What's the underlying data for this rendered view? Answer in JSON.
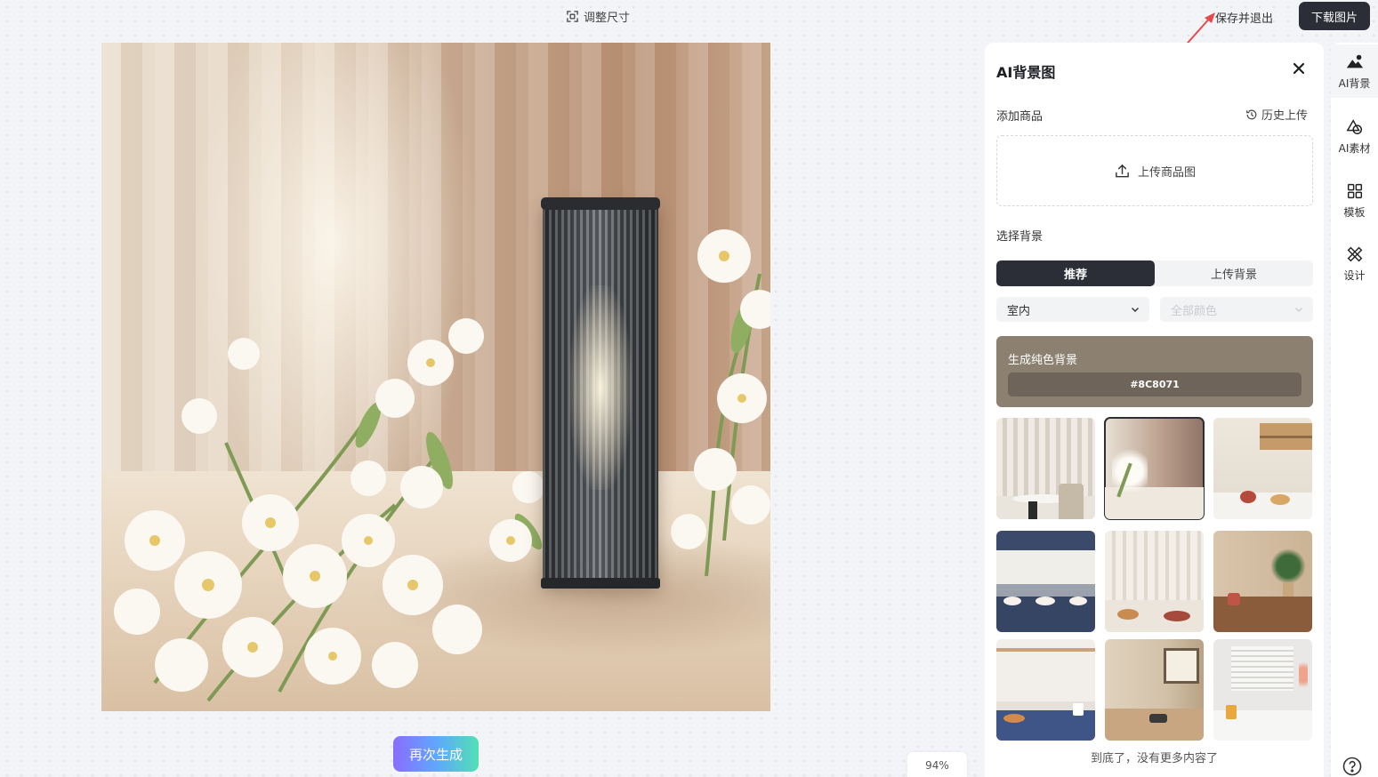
{
  "topbar": {
    "resize_label": "调整尺寸",
    "save_exit_label": "保存并退出",
    "download_label": "下载图片"
  },
  "canvas": {
    "regenerate_label": "再次生成",
    "zoom_level": "94%"
  },
  "panel": {
    "title": "AI背景图",
    "add_product_label": "添加商品",
    "history_label": "历史上传",
    "upload_label": "上传商品图",
    "choose_bg_label": "选择背景",
    "tabs": [
      {
        "label": "推荐",
        "active": true
      },
      {
        "label": "上传背景",
        "active": false
      }
    ],
    "scene_select": "室内",
    "color_select": "全部颜色",
    "solid_bg": {
      "title": "生成纯色背景",
      "hex": "#8C8071"
    },
    "end_text": "到底了，没有更多内容了"
  },
  "sidebar": {
    "tools": [
      {
        "label": "AI背景",
        "icon": "ai-background-icon",
        "active": true
      },
      {
        "label": "AI素材",
        "icon": "ai-material-icon",
        "active": false
      },
      {
        "label": "模板",
        "icon": "template-grid-icon",
        "active": false
      },
      {
        "label": "设计",
        "icon": "design-icon",
        "active": false
      }
    ]
  },
  "colors": {
    "dark": "#2b2e36",
    "solid_bg": "#8c8071",
    "annotation_arrow": "#e8474c"
  }
}
